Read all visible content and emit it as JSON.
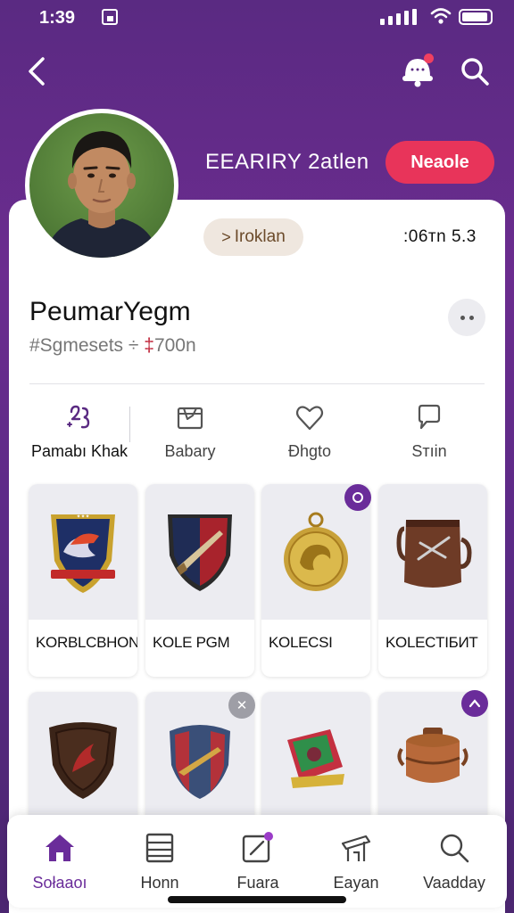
{
  "status_bar": {
    "time": "1:39"
  },
  "header": {
    "count_text": "EEARIRY 2atlen",
    "follow_label": "Neaole"
  },
  "profile": {
    "chip_arrow": ">",
    "chip_label": "Iroklan",
    "stat_text": ":06тn 5.3",
    "name": "PeumarYegm",
    "subtitle_prefix": "#Sgmesets ÷ ",
    "subtitle_accent": "‡",
    "subtitle_suffix": "700n"
  },
  "tabs": [
    {
      "label": "Pamabı Khak",
      "icon": "sparkle-text-icon"
    },
    {
      "label": "Babary",
      "icon": "box-icon"
    },
    {
      "label": "Đhgto",
      "icon": "heart-icon"
    },
    {
      "label": "Sᴛıin",
      "icon": "bookmark-icon"
    }
  ],
  "collections": [
    {
      "label": "KORBLCBHON",
      "image": "crest-shield"
    },
    {
      "label": "KOLE PGM",
      "image": "sword-shield"
    },
    {
      "label": "KOLECSI",
      "image": "gold-medal"
    },
    {
      "label": "KOLECTIБИT",
      "image": "leather-bag"
    },
    {
      "label": "",
      "image": "dark-shield"
    },
    {
      "label": "",
      "image": "red-blue-shield"
    },
    {
      "label": "",
      "image": "green-red-badge"
    },
    {
      "label": "",
      "image": "copper-pot"
    }
  ],
  "bottom_nav": [
    {
      "label": "Sołaaoı",
      "icon": "home-icon",
      "active": true
    },
    {
      "label": "Honn",
      "icon": "list-icon",
      "active": false
    },
    {
      "label": "Fuara",
      "icon": "edit-icon",
      "active": false
    },
    {
      "label": "Eayan",
      "icon": "stand-icon",
      "active": false
    },
    {
      "label": "Vaadday",
      "icon": "search-icon",
      "active": false
    }
  ],
  "colors": {
    "accent": "#e8345a",
    "brand_purple": "#6a2c9a",
    "background": "#5a2a82"
  }
}
